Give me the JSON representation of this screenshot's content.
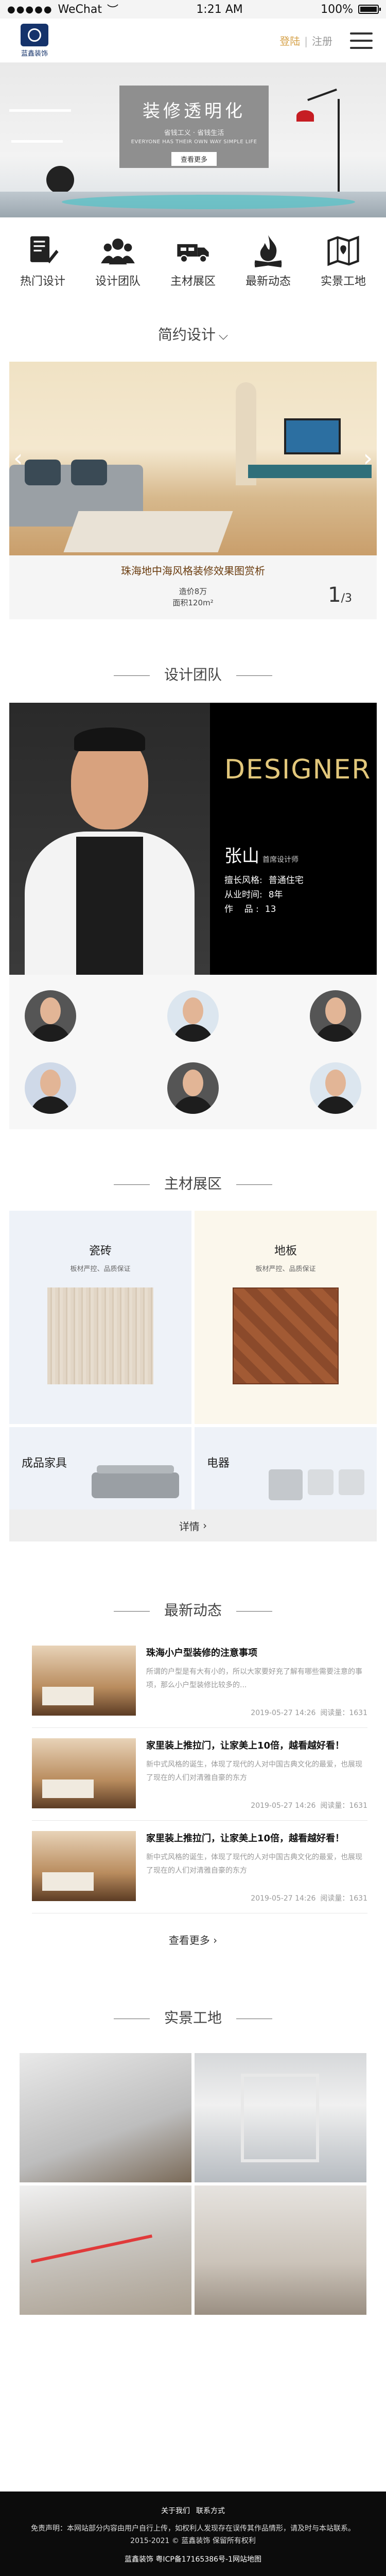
{
  "status_bar": {
    "carrier": "WeChat",
    "time": "1:21 AM",
    "battery": "100%"
  },
  "header": {
    "logo_text": "蓝鑫装饰",
    "login": "登陆",
    "separator": "|",
    "register": "注册"
  },
  "hero": {
    "title": "装修透明化",
    "subtitle": "省钱工义 · 省钱生活",
    "tagline": "EVERYONE HAS THEIR OWN WAY SIMPLE LIFE",
    "button": "查看更多"
  },
  "nav": [
    {
      "label": "热门设计",
      "icon": "document-edit-icon"
    },
    {
      "label": "设计团队",
      "icon": "team-icon"
    },
    {
      "label": "主材展区",
      "icon": "truck-icon"
    },
    {
      "label": "最新动态",
      "icon": "fire-icon"
    },
    {
      "label": "实景工地",
      "icon": "map-icon"
    }
  ],
  "design": {
    "section_title": "简约设计",
    "caption": "珠海地中海风格装修效果图赏析",
    "price": "造价8万",
    "area": "面积120m²",
    "page_current": "1",
    "page_total": "/3"
  },
  "team": {
    "section_title": "设计团队",
    "designer_word": "DESIGNER",
    "name": "张山",
    "role": "首席设计师",
    "attrs": [
      {
        "k": "擅长风格:",
        "v": "普通住宅"
      },
      {
        "k": "从业时间:",
        "v": "8年"
      },
      {
        "k": "作    品 :",
        "v": "13"
      }
    ]
  },
  "materials": {
    "section_title": "主材展区",
    "items": [
      {
        "name": "瓷砖",
        "desc": "板材严控、品质保证"
      },
      {
        "name": "地板",
        "desc": "板材严控、品质保证"
      },
      {
        "name": "成品家具"
      },
      {
        "name": "电器"
      }
    ],
    "more": "详情"
  },
  "news": {
    "section_title": "最新动态",
    "items": [
      {
        "title": "珠海小户型装修的注意事项",
        "desc": "所谓的户型是有大有小的，所以大家要好充了解有哪些需要注意的事项，那么小户型装修比较多的...",
        "date": "2019-05-27 14:26",
        "views": "阅读量：1631"
      },
      {
        "title": "家里装上推拉门，让家美上10倍，越看越好看！",
        "desc": "新中式风格的诞生，体现了现代的人对中国古典文化的最爱，也展现了现在的人们对清雅自豪的东方",
        "date": "2019-05-27 14:26",
        "views": "阅读量：1631"
      },
      {
        "title": "家里装上推拉门，让家美上10倍，越看越好看！",
        "desc": "新中式风格的诞生，体现了现代的人对中国古典文化的最爱，也展现了现在的人们对清雅自豪的东方",
        "date": "2019-05-27 14:26",
        "views": "阅读量：1631"
      }
    ],
    "more": "查看更多"
  },
  "site": {
    "section_title": "实景工地"
  },
  "footer": {
    "links": [
      "关于我们",
      "联系方式"
    ],
    "disclaimer": "免责声明：本网站部分内容由用户自行上传，如权利人发现存在误传其作品情形，请及时与本站联系。2015-2021 © 蓝鑫装饰 保留所有权利",
    "copyright": "蓝鑫装饰 粤ICP备17165386号-1网站地图"
  },
  "colors": {
    "accent_gold": "#d6a24a",
    "designer_gold": "#e2c77b",
    "caption_brown": "#6b3d10",
    "logo_blue": "#15336b"
  }
}
